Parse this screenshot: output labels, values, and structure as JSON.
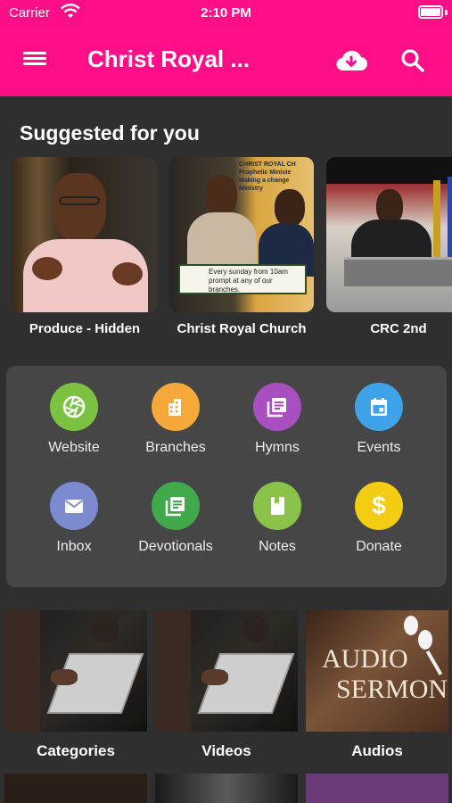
{
  "status_bar": {
    "carrier": "Carrier",
    "time": "2:10 PM"
  },
  "app_bar": {
    "title": "Christ Royal ...",
    "icons": [
      "menu-icon",
      "cloud-download-icon",
      "search-icon"
    ]
  },
  "suggested": {
    "title": "Suggested for you",
    "items": [
      {
        "label": "Produce - Hidden"
      },
      {
        "label": "Christ Royal Church"
      },
      {
        "label": "CRC 2nd"
      }
    ],
    "banner_text": "Every sunday from 10am prompt at any of our branches."
  },
  "menu_grid": [
    {
      "label": "Website",
      "icon": "aperture-icon",
      "color": "#7cc242"
    },
    {
      "label": "Branches",
      "icon": "building-icon",
      "color": "#f6a93b"
    },
    {
      "label": "Hymns",
      "icon": "library-books-icon",
      "color": "#a94fc0"
    },
    {
      "label": "Events",
      "icon": "calendar-icon",
      "color": "#3ea3e8"
    },
    {
      "label": "Inbox",
      "icon": "envelope-icon",
      "color": "#7c8bd0"
    },
    {
      "label": "Devotionals",
      "icon": "library-books-icon",
      "color": "#3fa94b"
    },
    {
      "label": "Notes",
      "icon": "book-icon",
      "color": "#8bc34a"
    },
    {
      "label": "Donate",
      "icon": "dollar-icon",
      "color": "#f3cc13"
    }
  ],
  "categories": [
    {
      "label": "Categories"
    },
    {
      "label": "Videos"
    },
    {
      "label": "Audios",
      "art_text": [
        "AUDIO",
        "SERMONS"
      ]
    }
  ],
  "colors": {
    "app_bar": "#ff0f87",
    "background": "#2f2f2f",
    "card": "#464646"
  }
}
